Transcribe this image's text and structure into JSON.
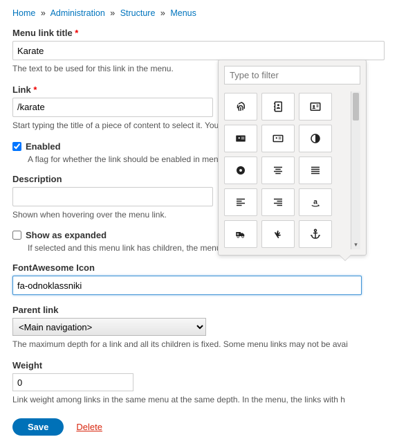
{
  "breadcrumb": [
    {
      "label": "Home"
    },
    {
      "label": "Administration"
    },
    {
      "label": "Structure"
    },
    {
      "label": "Menus"
    }
  ],
  "fields": {
    "title": {
      "label": "Menu link title",
      "value": "Karate",
      "description": "The text to be used for this link in the menu."
    },
    "link": {
      "label": "Link",
      "value": "/karate",
      "description": "Start typing the title of a piece of content to select it. You can also enter an internal path su"
    },
    "enabled": {
      "label": "Enabled",
      "description": "A flag for whether the link should be enabled in menus or hidden."
    },
    "description": {
      "label": "Description",
      "value": "",
      "description": "Shown when hovering over the menu link."
    },
    "expanded": {
      "label": "Show as expanded",
      "description": "If selected and this menu link has children, the menu will always appear expanded."
    },
    "fa_icon": {
      "label": "FontAwesome Icon",
      "value": "fa-odnoklassniki"
    },
    "parent": {
      "label": "Parent link",
      "value": "<Main navigation>",
      "description": "The maximum depth for a link and all its children is fixed. Some menu links may not be avai"
    },
    "weight": {
      "label": "Weight",
      "value": "0",
      "description": "Link weight among links in the same menu at the same depth. In the menu, the links with h"
    }
  },
  "actions": {
    "save": "Save",
    "delete": "Delete"
  },
  "icon_picker": {
    "filter_placeholder": "Type to filter",
    "icons": [
      "fingerprint-icon",
      "address-book-icon",
      "address-card-icon",
      "id-card-icon",
      "id-badge-icon",
      "adjust-icon",
      "circle-dot-icon",
      "align-center-icon",
      "align-justify-icon",
      "align-left-icon",
      "align-right-icon",
      "amazon-icon",
      "ambulance-icon",
      "sign-language-icon",
      "anchor-icon"
    ]
  }
}
